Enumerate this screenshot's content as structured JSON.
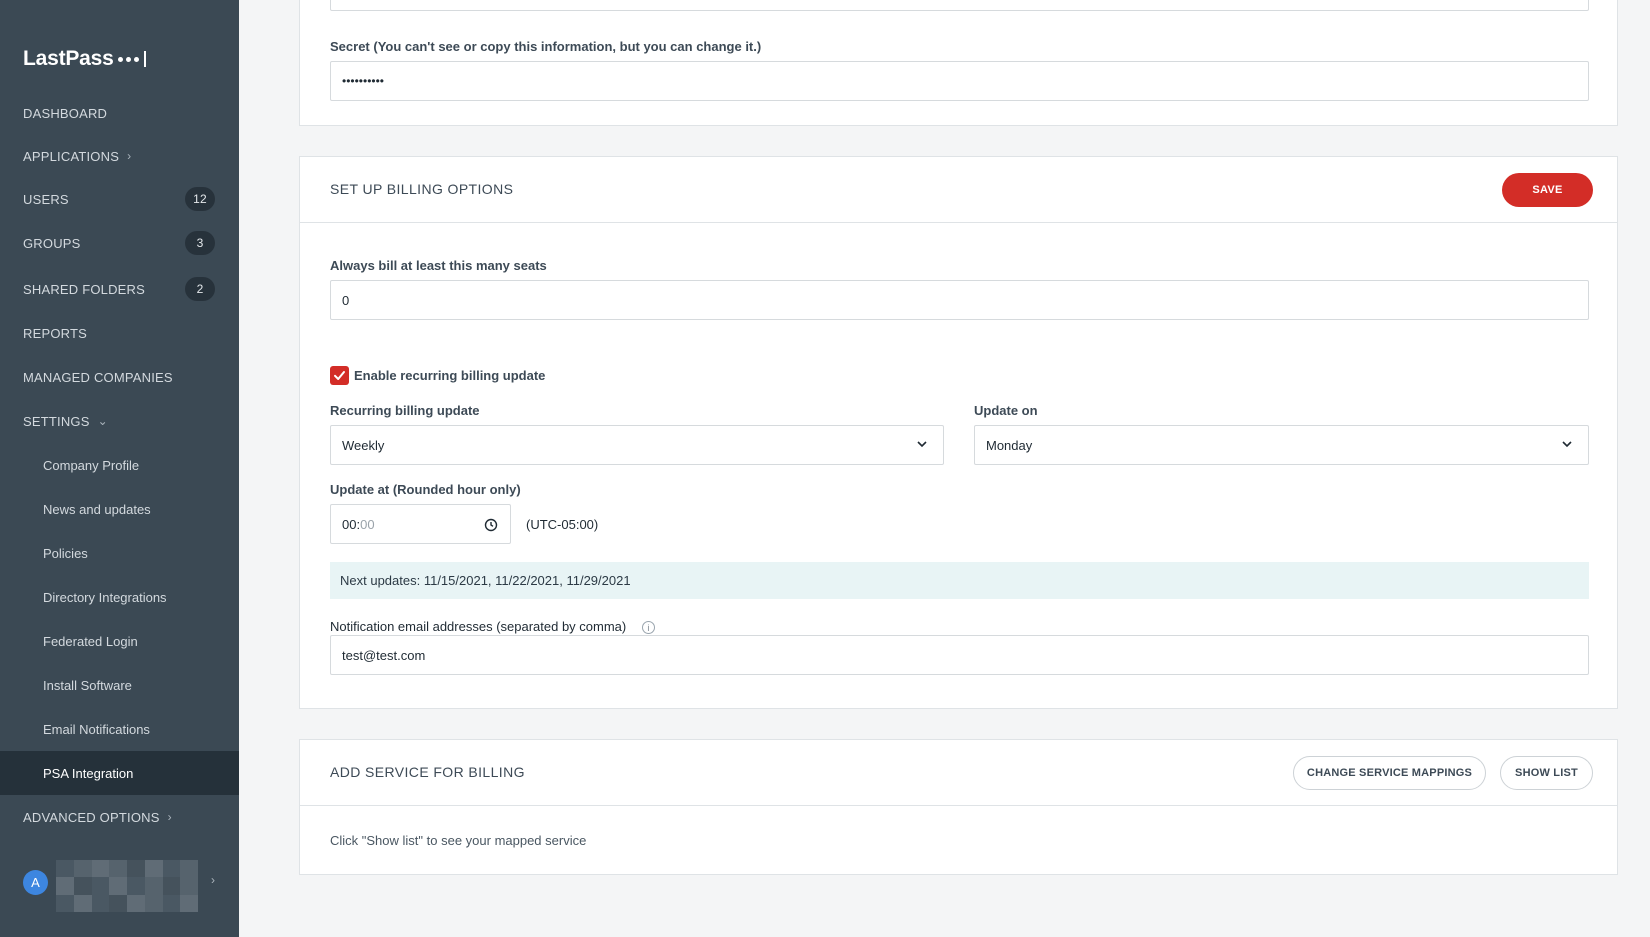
{
  "brand": "LastPass",
  "sidebar": {
    "items": [
      {
        "label": "DASHBOARD"
      },
      {
        "label": "APPLICATIONS"
      },
      {
        "label": "USERS",
        "count": "12"
      },
      {
        "label": "GROUPS",
        "count": "3"
      },
      {
        "label": "SHARED FOLDERS",
        "count": "2"
      },
      {
        "label": "REPORTS"
      },
      {
        "label": "MANAGED COMPANIES"
      },
      {
        "label": "SETTINGS"
      }
    ],
    "settings_items": [
      {
        "label": "Company Profile"
      },
      {
        "label": "News and updates"
      },
      {
        "label": "Policies"
      },
      {
        "label": "Directory Integrations"
      },
      {
        "label": "Federated Login"
      },
      {
        "label": "Install Software"
      },
      {
        "label": "Email Notifications"
      },
      {
        "label": "PSA Integration"
      }
    ],
    "advanced": "ADVANCED OPTIONS",
    "user_initial": "A"
  },
  "credentials": {
    "secret_label": "Secret (You can't see or copy this information, but you can change it.)",
    "secret_value": "••••••••••"
  },
  "billing": {
    "title": "SET UP BILLING OPTIONS",
    "save": "SAVE",
    "min_seats_label": "Always bill at least this many seats",
    "min_seats_value": "0",
    "enable_recurring": "Enable recurring billing update",
    "recurring_label": "Recurring billing update",
    "recurring_value": "Weekly",
    "update_on_label": "Update on",
    "update_on_value": "Monday",
    "update_at_label": "Update at (Rounded hour only)",
    "update_at_hour": "00",
    "update_at_minute": "00",
    "timezone": "(UTC-05:00)",
    "next_updates": "Next updates: 11/15/2021, 11/22/2021, 11/29/2021",
    "notification_label": "Notification email addresses (separated by comma)",
    "notification_value": "test@test.com"
  },
  "service": {
    "title": "ADD SERVICE FOR BILLING",
    "change_mappings": "CHANGE SERVICE MAPPINGS",
    "show_list": "SHOW LIST",
    "hint": "Click \"Show list\" to see your mapped service"
  },
  "colors": {
    "sidebar_bg": "#3b4954",
    "active_bg": "#25313a",
    "accent_red": "#d32d27",
    "info_bg": "#e8f4f5"
  }
}
